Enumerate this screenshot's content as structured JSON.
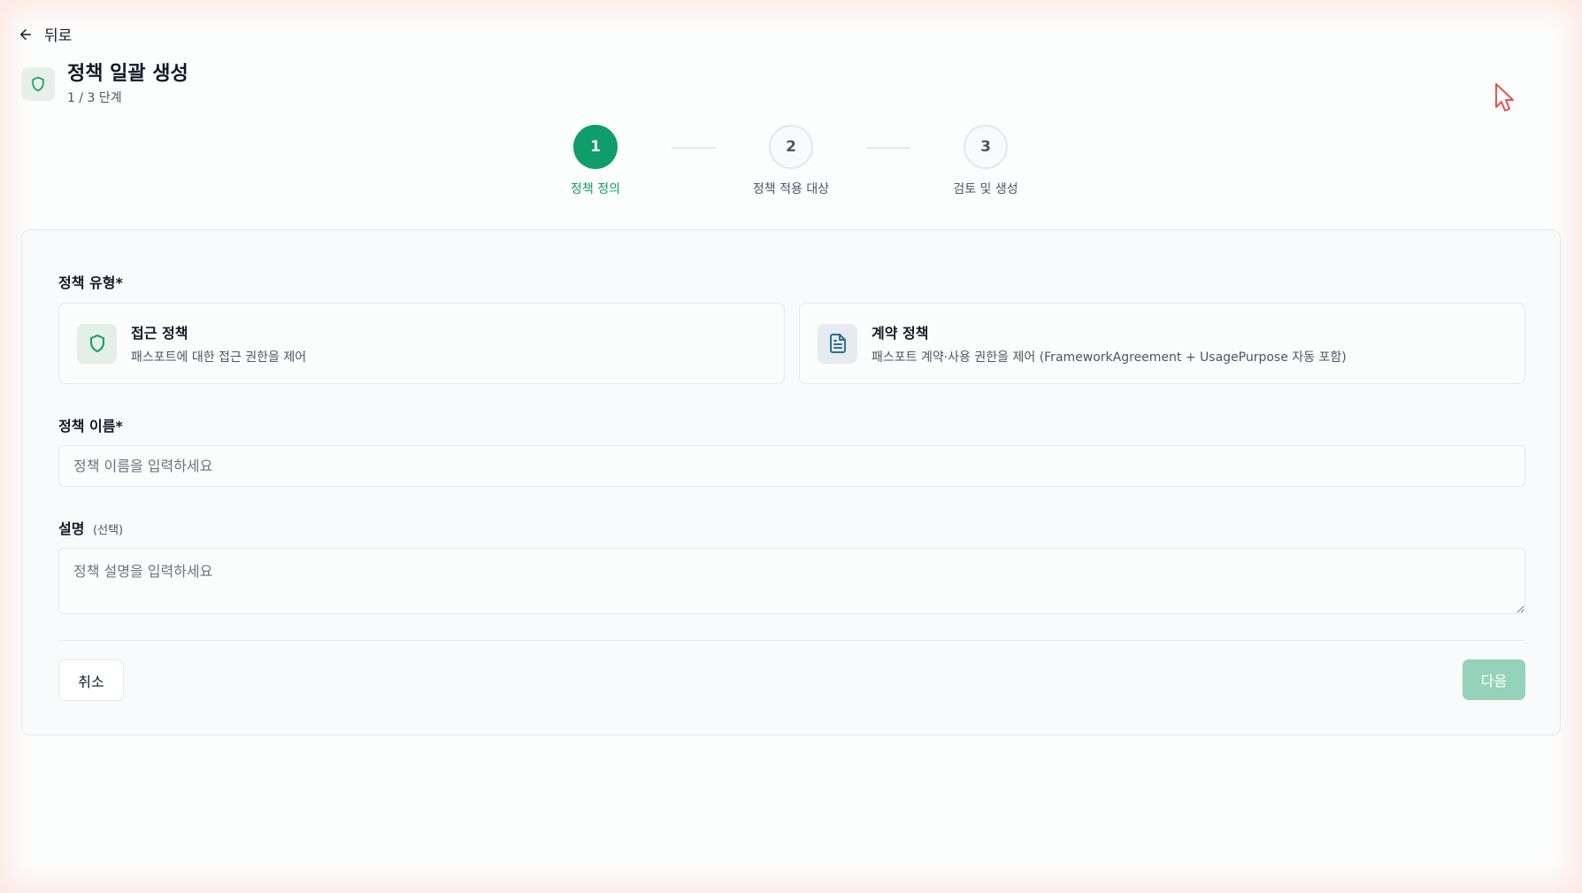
{
  "nav": {
    "back_label": "뒤로"
  },
  "header": {
    "title": "정책 일괄 생성",
    "subtitle": "1 / 3 단계"
  },
  "stepper": {
    "steps": [
      {
        "number": "1",
        "label": "정책 정의",
        "state": "active"
      },
      {
        "number": "2",
        "label": "정책 적용 대상",
        "state": "inactive"
      },
      {
        "number": "3",
        "label": "검토 및 생성",
        "state": "inactive"
      }
    ]
  },
  "form": {
    "policy_type": {
      "label": "정책 유형*",
      "options": [
        {
          "title": "접근 정책",
          "description": "패스포트에 대한 접근 권한을 제어",
          "icon": "shield-icon"
        },
        {
          "title": "계약 정책",
          "description": "패스포트 계약·사용 권한을 제어 (FrameworkAgreement + UsagePurpose 자동 포함)",
          "icon": "document-icon"
        }
      ]
    },
    "policy_name": {
      "label": "정책 이름*",
      "placeholder": "정책 이름을 입력하세요",
      "value": ""
    },
    "description": {
      "label": "설명",
      "optional_label": "(선택)",
      "placeholder": "정책 설명을 입력하세요",
      "value": ""
    }
  },
  "actions": {
    "cancel_label": "취소",
    "next_label": "다음"
  },
  "colors": {
    "accent": "#0f9d6b",
    "accent_disabled": "#94d3b9",
    "border": "#e5e7eb",
    "muted_text": "#4b5563"
  }
}
